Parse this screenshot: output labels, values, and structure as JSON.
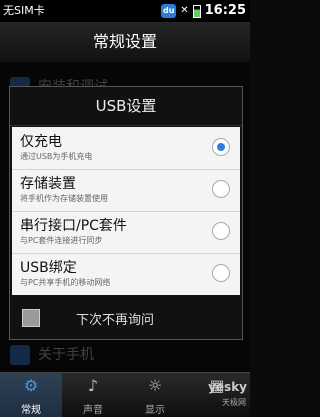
{
  "status_bar": {
    "carrier": "无SIM卡",
    "badge": "du",
    "time": "16:25"
  },
  "title": "常规设置",
  "background_items": {
    "top": "安装和调试",
    "bottom": "关于手机"
  },
  "dialog": {
    "title": "USB设置",
    "options": [
      {
        "title": "仅充电",
        "subtitle": "通过USB为手机充电",
        "selected": true
      },
      {
        "title": "存储装置",
        "subtitle": "将手机作为存储装置使用",
        "selected": false
      },
      {
        "title": "串行接口/PC套件",
        "subtitle": "与PC套件连接进行同步",
        "selected": false
      },
      {
        "title": "USB绑定",
        "subtitle": "与PC共享手机的移动网络",
        "selected": false
      }
    ],
    "dont_ask_label": "下次不再询问",
    "dont_ask_checked": false
  },
  "bottom_nav": [
    {
      "label": "常规",
      "icon": "gear-icon",
      "active": true
    },
    {
      "label": "声音",
      "icon": "speaker-icon",
      "active": false
    },
    {
      "label": "显示",
      "icon": "brightness-icon",
      "active": false
    },
    {
      "label": "",
      "icon": "more-icon",
      "active": false
    }
  ],
  "watermark": {
    "brand": "yesky",
    "sub": "天极网"
  },
  "colors": {
    "accent": "#2f7ce0"
  }
}
